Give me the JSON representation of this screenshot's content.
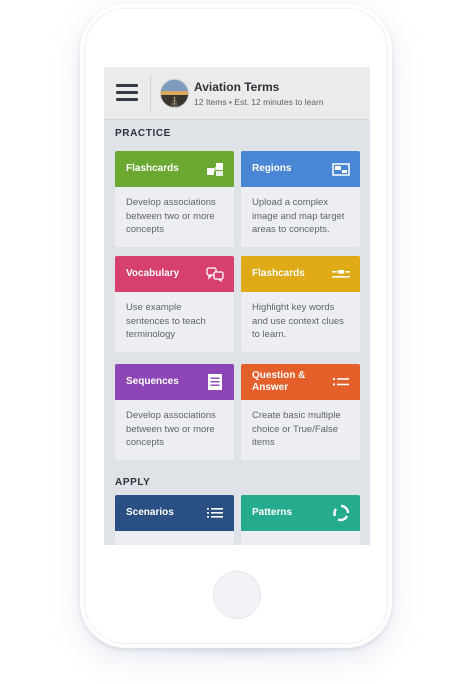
{
  "header": {
    "title": "Aviation Terms",
    "subtitle": "12 Items • Est. 12 minutes to learn"
  },
  "sections": {
    "practice": "PRACTICE",
    "apply": "APPLY"
  },
  "cards": {
    "flashcards_1": {
      "title": "Flashcards",
      "desc": "Develop associations between two or more concepts",
      "color": "#6aa832",
      "icon": "flashcards-icon"
    },
    "regions": {
      "title": "Regions",
      "desc": "Upload a complex image and map target areas to concepts.",
      "color": "#4a86d6",
      "icon": "image-regions-icon"
    },
    "vocabulary": {
      "title": "Vocabulary",
      "desc": "Use example sentences to teach terminology",
      "color": "#d63f6e",
      "icon": "speech-bubbles-icon"
    },
    "flashcards_2": {
      "title": "Flashcards",
      "desc": "Highlight key words and use context clues to learn.",
      "color": "#dfaa15",
      "icon": "highlight-lines-icon"
    },
    "sequences": {
      "title": "Sequences",
      "desc": "Develop associations between two or more concepts",
      "color": "#8e45b5",
      "icon": "list-document-icon"
    },
    "question_answer": {
      "title": "Question & Answer",
      "desc": "Create basic multiple choice or True/False items",
      "color": "#e3602b",
      "icon": "checklist-icon"
    },
    "scenarios": {
      "title": "Scenarios",
      "color": "#2a4f85",
      "icon": "scenario-list-icon"
    },
    "patterns": {
      "title": "Patterns",
      "color": "#25ac8f",
      "icon": "pattern-cycle-icon"
    }
  }
}
